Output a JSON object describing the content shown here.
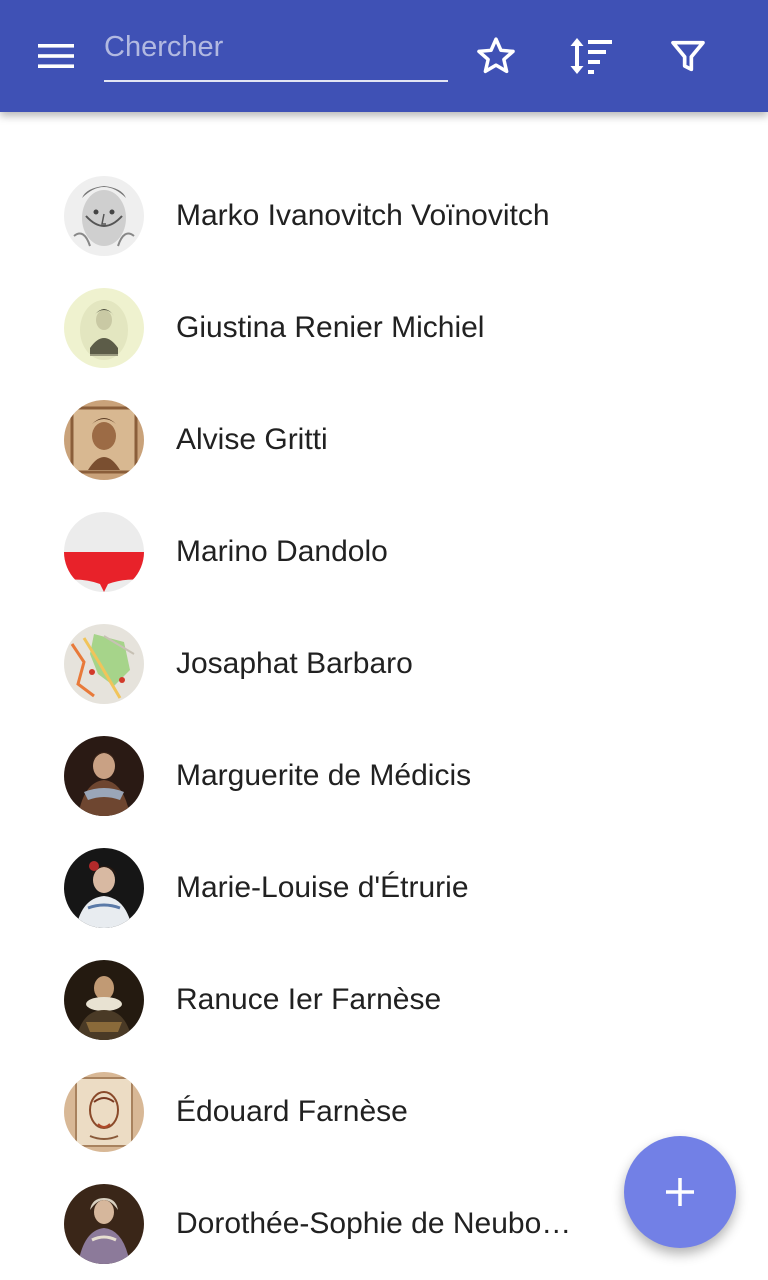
{
  "toolbar": {
    "search_placeholder": "Chercher",
    "icons": {
      "menu": "menu-icon",
      "favorites": "star-outline-icon",
      "sort": "sort-icon",
      "filter": "filter-icon"
    },
    "colors": {
      "appbar": "#3F51B5",
      "fab": "#7280E6",
      "text": "#212121"
    }
  },
  "people": [
    {
      "name": "Marko Ivanovitch Voïnovitch"
    },
    {
      "name": "Giustina Renier Michiel"
    },
    {
      "name": "Alvise Gritti"
    },
    {
      "name": "Marino Dandolo"
    },
    {
      "name": "Josaphat Barbaro"
    },
    {
      "name": "Marguerite de Médicis"
    },
    {
      "name": "Marie-Louise d'Étrurie"
    },
    {
      "name": "Ranuce Ier Farnèse"
    },
    {
      "name": "Édouard Farnèse"
    },
    {
      "name": "Dorothée-Sophie de Neubourg"
    }
  ],
  "fab": {
    "icon": "plus-icon"
  }
}
